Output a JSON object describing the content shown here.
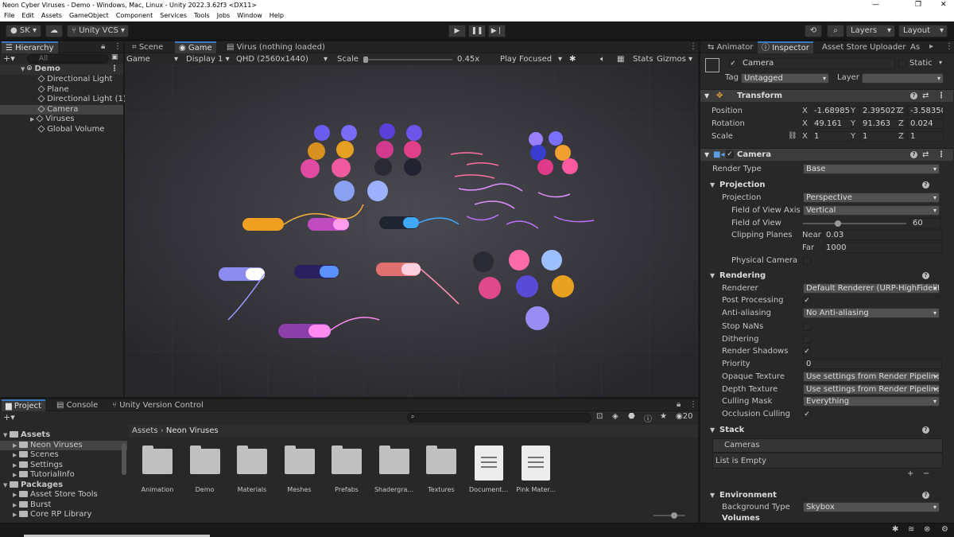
{
  "window": {
    "title": "Neon Cyber Viruses - Demo - Windows, Mac, Linux - Unity 2022.3.62f3 <DX11>",
    "minimize": "—",
    "restore": "❐",
    "close": "✕"
  },
  "menu": [
    "File",
    "Edit",
    "Assets",
    "GameObject",
    "Component",
    "Services",
    "Tools",
    "Jobs",
    "Window",
    "Help"
  ],
  "toolbar": {
    "account": "SK",
    "vcs": "Unity VCS",
    "layers": "Layers",
    "layout": "Layout"
  },
  "hierarchy": {
    "tab": "Hierarchy",
    "search_placeholder": "All",
    "root": "Demo",
    "items": [
      "Directional Light",
      "Plane",
      "Directional Light (1)",
      "Camera",
      "Viruses",
      "Global Volume"
    ]
  },
  "game": {
    "tabs": [
      "Scene",
      "Game",
      "Virus (nothing loaded)"
    ],
    "mode": "Game",
    "display": "Display 1",
    "resolution": "QHD (2560x1440)",
    "scale_label": "Scale",
    "scale_value": "0.45x",
    "play_focused": "Play Focused",
    "stats": "Stats",
    "gizmos": "Gizmos"
  },
  "project": {
    "tabs": [
      "Project",
      "Console",
      "Unity Version Control"
    ],
    "count": "20",
    "tree": [
      {
        "label": "Assets",
        "level": 0,
        "bold": true
      },
      {
        "label": "Neon Viruses",
        "level": 1,
        "sel": true
      },
      {
        "label": "Scenes",
        "level": 1
      },
      {
        "label": "Settings",
        "level": 1
      },
      {
        "label": "TutorialInfo",
        "level": 1
      },
      {
        "label": "Packages",
        "level": 0,
        "bold": true
      },
      {
        "label": "Asset Store Tools",
        "level": 1
      },
      {
        "label": "Burst",
        "level": 1
      },
      {
        "label": "Core RP Library",
        "level": 1
      }
    ],
    "breadcrumb": [
      "Assets",
      "Neon Viruses"
    ],
    "assets": [
      {
        "label": "Animation",
        "kind": "folder"
      },
      {
        "label": "Demo",
        "kind": "folder"
      },
      {
        "label": "Materials",
        "kind": "folder"
      },
      {
        "label": "Meshes",
        "kind": "folder"
      },
      {
        "label": "Prefabs",
        "kind": "folder"
      },
      {
        "label": "Shadergra...",
        "kind": "folder"
      },
      {
        "label": "Textures",
        "kind": "folder"
      },
      {
        "label": "Document...",
        "kind": "doc"
      },
      {
        "label": "Pink Mater...",
        "kind": "doc"
      }
    ]
  },
  "inspector": {
    "tabs": [
      "Animator",
      "Inspector",
      "Asset Store Uploader",
      "As"
    ],
    "object_name": "Camera",
    "static_label": "Static",
    "tag_label": "Tag",
    "tag": "Untagged",
    "layer_label": "Layer",
    "layer": "",
    "transform": {
      "title": "Transform",
      "position_label": "Position",
      "position": [
        "-1.68985",
        "2.395027",
        "-3.58350"
      ],
      "rotation_label": "Rotation",
      "rotation": [
        "49.161",
        "91.363",
        "0.024"
      ],
      "scale_label": "Scale",
      "scale": [
        "1",
        "1",
        "1"
      ]
    },
    "camera": {
      "title": "Camera",
      "render_type_label": "Render Type",
      "render_type": "Base",
      "projection_section": "Projection",
      "projection_label": "Projection",
      "projection": "Perspective",
      "fov_axis_label": "Field of View Axis",
      "fov_axis": "Vertical",
      "fov_label": "Field of View",
      "fov": "60",
      "clipping_label": "Clipping Planes",
      "near_label": "Near",
      "near": "0.03",
      "far_label": "Far",
      "far": "1000",
      "physical_label": "Physical Camera",
      "rendering_section": "Rendering",
      "renderer_label": "Renderer",
      "renderer": "Default Renderer (URP-HighFidelity",
      "post_label": "Post Processing",
      "aa_label": "Anti-aliasing",
      "aa": "No Anti-aliasing",
      "nan_label": "Stop NaNs",
      "dither_label": "Dithering",
      "shadows_label": "Render Shadows",
      "priority_label": "Priority",
      "priority": "0",
      "opaque_label": "Opaque Texture",
      "opaque": "Use settings from Render Pipeline A",
      "depth_label": "Depth Texture",
      "depth": "Use settings from Render Pipeline A",
      "culling_label": "Culling Mask",
      "culling": "Everything",
      "occlusion_label": "Occlusion Culling",
      "stack_section": "Stack",
      "cameras_label": "Cameras",
      "list_empty": "List is Empty",
      "env_section": "Environment",
      "bg_label": "Background Type",
      "bg": "Skybox",
      "volumes_label": "Volumes"
    }
  },
  "colors": {
    "accent": "#3a79bb",
    "panel": "#282828",
    "selection": "#444444"
  }
}
